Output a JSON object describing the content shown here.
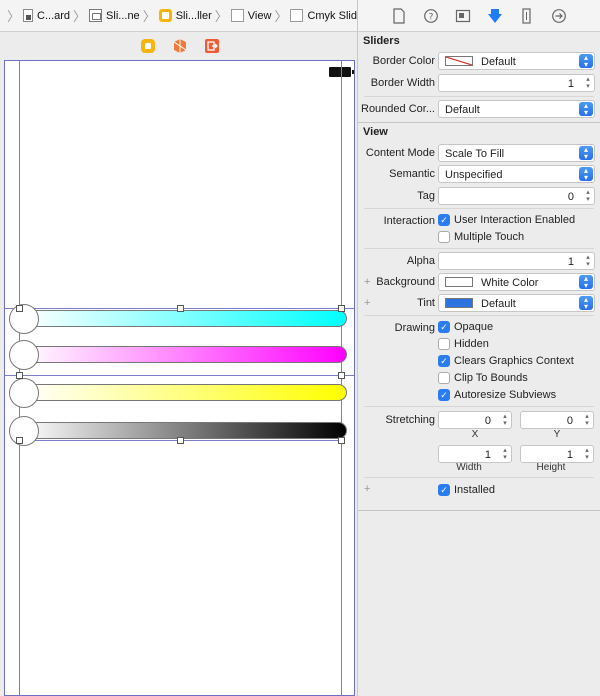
{
  "breadcrumb": [
    {
      "icon": "swift-file-icon",
      "label": "C...ard"
    },
    {
      "icon": "storyboard-icon",
      "label": "Sli...ne"
    },
    {
      "icon": "view-controller-icon",
      "label": "Sli...ller"
    },
    {
      "icon": "view-icon",
      "label": "View"
    },
    {
      "icon": "view-icon",
      "label": "Cmyk Sliders"
    }
  ],
  "canvas": {
    "scene_icons": [
      "view-controller-icon",
      "first-responder-icon",
      "exit-icon"
    ],
    "sliders": [
      {
        "name": "cyan",
        "color": "#00ffff"
      },
      {
        "name": "magenta",
        "color": "#ff00ff"
      },
      {
        "name": "yellow",
        "color": "#ffff00"
      },
      {
        "name": "black",
        "color": "#000000"
      }
    ]
  },
  "inspector": {
    "tabs": [
      "file-icon",
      "help-icon",
      "identity-icon",
      "attributes-icon",
      "size-icon",
      "connections-icon"
    ],
    "sliders_section": {
      "title": "Sliders",
      "border_color_label": "Border Color",
      "border_color_value": "Default",
      "border_width_label": "Border Width",
      "border_width_value": "1",
      "rounded_corners_label": "Rounded Cor...",
      "rounded_corners_value": "Default"
    },
    "view_section": {
      "title": "View",
      "content_mode_label": "Content Mode",
      "content_mode_value": "Scale To Fill",
      "semantic_label": "Semantic",
      "semantic_value": "Unspecified",
      "tag_label": "Tag",
      "tag_value": "0",
      "interaction_label": "Interaction",
      "user_interaction": "User Interaction Enabled",
      "multiple_touch": "Multiple Touch",
      "alpha_label": "Alpha",
      "alpha_value": "1",
      "background_label": "Background",
      "background_value": "White Color",
      "tint_label": "Tint",
      "tint_value": "Default",
      "tint_color": "#2b74e0",
      "drawing_label": "Drawing",
      "opaque": "Opaque",
      "hidden": "Hidden",
      "clears_context": "Clears Graphics Context",
      "clip_to_bounds": "Clip To Bounds",
      "autoresize": "Autoresize Subviews",
      "stretching_label": "Stretching",
      "stretch_x": "0",
      "stretch_y": "0",
      "stretch_x_label": "X",
      "stretch_y_label": "Y",
      "stretch_width": "1",
      "stretch_height": "1",
      "width_label": "Width",
      "height_label": "Height",
      "installed": "Installed"
    }
  }
}
